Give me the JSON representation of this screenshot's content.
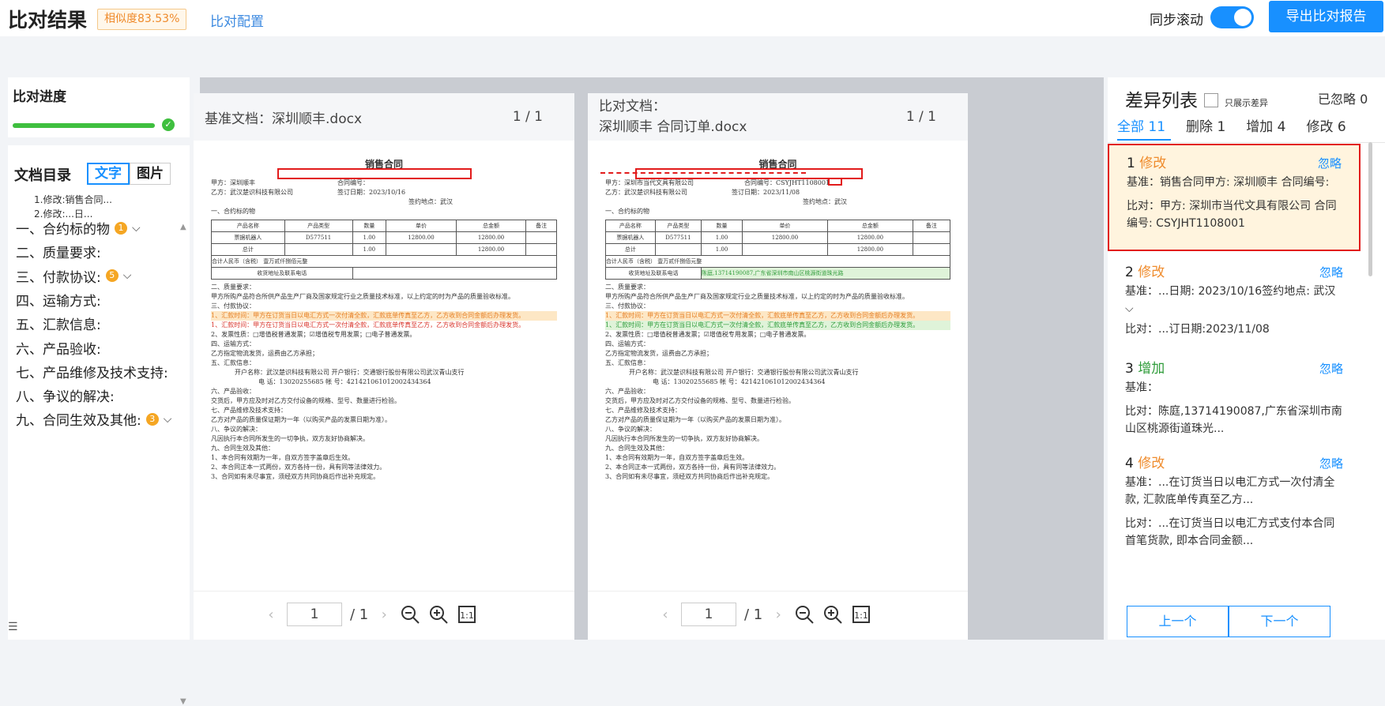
{
  "header": {
    "title": "比对结果",
    "similarity": "相似度83.53%",
    "config_link": "比对配置",
    "sync_label": "同步滚动",
    "export_button": "导出比对报告"
  },
  "left": {
    "progress_title": "比对进度",
    "progress_fraction": 1.0,
    "toc_title": "文档目录",
    "toc_tabs": [
      "文字",
      "图片"
    ],
    "toc_sub": [
      "1.修改:销售合同...",
      "2.修改:...日..."
    ],
    "toc_items": [
      {
        "label": "一、合约标的物",
        "badge": "1",
        "chevron": true
      },
      {
        "label": "二、质量要求:",
        "badge": "",
        "chevron": false
      },
      {
        "label": "三、付款协议:",
        "badge": "5",
        "chevron": true
      },
      {
        "label": "四、运输方式:",
        "badge": "",
        "chevron": false
      },
      {
        "label": "五、汇款信息:",
        "badge": "",
        "chevron": false
      },
      {
        "label": "六、产品验收:",
        "badge": "",
        "chevron": false
      },
      {
        "label": "七、产品维修及技术支持:",
        "badge": "",
        "chevron": false
      },
      {
        "label": "八、争议的解决:",
        "badge": "",
        "chevron": false
      },
      {
        "label": "九、合同生效及其他:",
        "badge": "3",
        "chevron": true
      }
    ]
  },
  "base_doc": {
    "title": "基准文档：深圳顺丰.docx",
    "page": "1 / 1",
    "sheet_title": "销售合同",
    "party_a": "甲方：深圳顺丰",
    "contract_no": "合同编号：",
    "party_b": "乙方：武汉楚识科技有限公司",
    "sign_date": "签订日期：2023/10/16",
    "sign_place": "签约地点：武汉",
    "page_input": "1",
    "page_total": "/ 1"
  },
  "cmp_doc": {
    "title_line1": "比对文档：",
    "title_line2": "深圳顺丰 合同订单.docx",
    "page": "1 / 1",
    "sheet_title": "销售合同",
    "party_a": "甲方：深圳市当代文具有限公司",
    "contract_no": "合同编号：CSYJHT1108001",
    "party_b": "乙方：武汉楚识科技有限公司",
    "sign_date": "签订日期：2023/11/08",
    "sign_place": "签约地点：武汉",
    "page_input": "1",
    "page_total": "/ 1"
  },
  "doc_body": {
    "sec1": "一、合约标的物",
    "table_head": [
      "产品名称",
      "产品类型",
      "数量",
      "单价",
      "总金额",
      "备注"
    ],
    "table_row1": [
      "票据机器人",
      "D577511",
      "1.00",
      "12800.00",
      "12800.00",
      ""
    ],
    "table_row2": [
      "总计",
      "",
      "1.00",
      "",
      "12800.00",
      ""
    ],
    "rmb": "合计人民币（含税）  壹万贰仟捌佰元整",
    "address": "收货地址及联系电话",
    "address_value": "陈庭,13714190087,广东省深圳市南山区桃源街道珠光路",
    "sec2": "二、质量要求：",
    "sec2_text": "甲方所购产品符合所供产品生产厂商及国家规定行业之质量技术标准，以上约定的时为产品的质量验收标准。",
    "sec3": "三、付款协议：",
    "sec3_text": "1、汇款时间：甲方在订货当日以电汇方式一次付清全款，汇款底单传真至乙方，乙方收到合同金额后办理发货。",
    "sec3_text2": "2、发票性质：□增值税普通发票；☑增值税专用发票；□电子普通发票。",
    "sec4": "四、运输方式：",
    "sec4_text": "乙方指定物流发货，运费由乙方承担；",
    "sec5": "五、汇款信息：",
    "sec5_text": "开户名称：武汉楚识科技有限公司    开户银行：交通银行股份有限公司武汉青山支行",
    "sec5_text2": "电 话：13020255685    帐 号：421421061012002434364",
    "sec6": "六、产品验收：",
    "sec6_text": "交货后，甲方应及时对乙方交付设备的规格、型号、数量进行检验。",
    "sec7": "七、产品维修及技术支持：",
    "sec7_text": "乙方对产品的质量保证期为一年（以购买产品的发票日期为准）。",
    "sec8": "八、争议的解决：",
    "sec8_text": "凡因执行本合同所发生的一切争执，双方友好协商解决。",
    "sec9": "九、合同生效及其他：",
    "sec9_text": "1、本合同有效期为一年，自双方签字盖章后生效。",
    "sec9_text2": "2、本合同正本一式两份，双方各持一份，具有同等法律效力。",
    "sec9_text3": "3、合同如有未尽事宜，须经双方共同协商后作出补充规定。"
  },
  "diff": {
    "title": "差异列表",
    "only_show": "只展示差异",
    "ignored": "已忽略 0",
    "tabs": [
      "全部 11",
      "删除 1",
      "增加 4",
      "修改 6"
    ],
    "ignore_label": "忽略",
    "items": [
      {
        "num": "1",
        "type": "修改",
        "base": "基准：销售合同甲方: 深圳顺丰 合同编号:",
        "cmp": "比对：甲方: 深圳市当代文具有限公司 合同编号: CSYJHT1108001"
      },
      {
        "num": "2",
        "type": "修改",
        "base": "基准：...日期: 2023/10/16签约地点: 武汉",
        "cmp": "比对：...订日期:2023/11/08"
      },
      {
        "num": "3",
        "type": "增加",
        "base": "基准：",
        "cmp": "比对：陈庭,13714190087,广东省深圳市南山区桃源街道珠光..."
      },
      {
        "num": "4",
        "type": "修改",
        "base": "基准：...在订货当日以电汇方式一次付清全款, 汇款底单传真至乙方...",
        "cmp": "比对：...在订货当日以电汇方式支付本合同首笔货款, 即本合同金额..."
      }
    ],
    "prev": "上一个",
    "next": "下一个"
  },
  "colors": {
    "accent": "#1890ff",
    "modify": "#ef8b2c",
    "add": "#2f9c3a",
    "highlight_box": "#e21b1b"
  }
}
